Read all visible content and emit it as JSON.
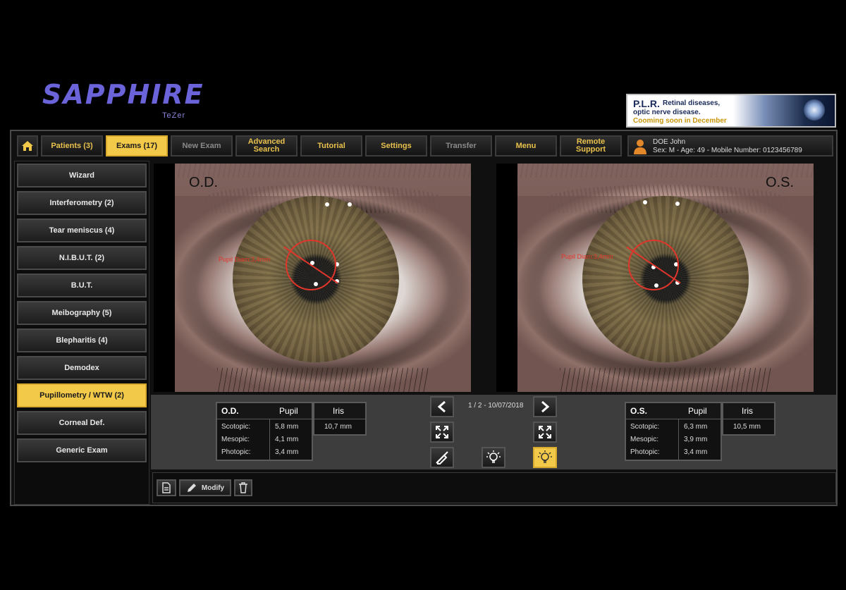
{
  "app": {
    "logo_text": "SAPPHIRE",
    "logo_sub": "TeZer"
  },
  "banner": {
    "title": "P.L.R.",
    "line1": "Retinal diseases,",
    "line2": "optic nerve disease.",
    "line3": "Cooming soon in December"
  },
  "nav": {
    "home_icon": "home-icon",
    "items": [
      {
        "label": "Patients (3)",
        "state": "normal"
      },
      {
        "label": "Exams (17)",
        "state": "active"
      },
      {
        "label": "New Exam",
        "state": "disabled"
      },
      {
        "label": "Advanced Search",
        "state": "normal"
      },
      {
        "label": "Tutorial",
        "state": "normal"
      },
      {
        "label": "Settings",
        "state": "normal"
      },
      {
        "label": "Transfer",
        "state": "disabled"
      },
      {
        "label": "Menu",
        "state": "normal"
      },
      {
        "label": "Remote Support",
        "state": "normal"
      }
    ]
  },
  "patient": {
    "name": "DOE John",
    "info": "Sex: M - Age: 49 - Mobile Number: 0123456789"
  },
  "sidebar": {
    "items": [
      {
        "label": "Wizard",
        "active": false
      },
      {
        "label": "Interferometry (2)",
        "active": false
      },
      {
        "label": "Tear meniscus (4)",
        "active": false
      },
      {
        "label": "N.I.B.U.T. (2)",
        "active": false
      },
      {
        "label": "B.U.T.",
        "active": false
      },
      {
        "label": "Meibography (5)",
        "active": false
      },
      {
        "label": "Blepharitis (4)",
        "active": false
      },
      {
        "label": "Demodex",
        "active": false
      },
      {
        "label": "Pupillometry / WTW (2)",
        "active": true
      },
      {
        "label": "Corneal Def.",
        "active": false
      },
      {
        "label": "Generic Exam",
        "active": false
      }
    ]
  },
  "eyes": {
    "right": {
      "tag": "O.D.",
      "pupil_label": "Pupil Diam:3,4mm"
    },
    "left": {
      "tag": "O.S.",
      "pupil_label": "Pupil Diam:3,4mm"
    }
  },
  "od_table": {
    "eye": "O.D.",
    "pupil_header": "Pupil",
    "iris_header": "Iris",
    "iris_value": "10,7 mm",
    "rows": [
      {
        "label": "Scotopic:",
        "value": "5,8 mm"
      },
      {
        "label": "Mesopic:",
        "value": "4,1 mm"
      },
      {
        "label": "Photopic:",
        "value": "3,4 mm"
      }
    ]
  },
  "os_table": {
    "eye": "O.S.",
    "pupil_header": "Pupil",
    "iris_header": "Iris",
    "iris_value": "10,5 mm",
    "rows": [
      {
        "label": "Scotopic:",
        "value": "6,3 mm"
      },
      {
        "label": "Mesopic:",
        "value": "3,9 mm"
      },
      {
        "label": "Photopic:",
        "value": "3,4 mm"
      }
    ]
  },
  "exam_nav": {
    "counter": "1 / 2 - 10/07/2018"
  },
  "toolbar": {
    "modify_label": "Modify"
  },
  "colors": {
    "accent": "#f3c94a",
    "measure": "#e0352b"
  }
}
